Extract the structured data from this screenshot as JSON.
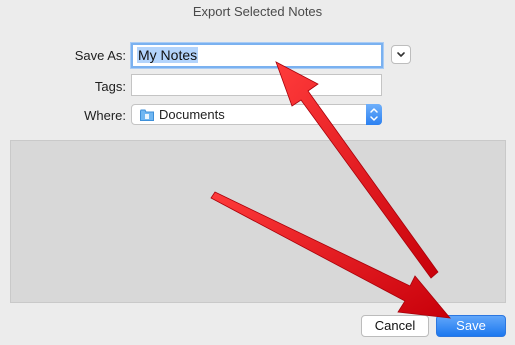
{
  "dialog": {
    "title": "Export Selected Notes"
  },
  "form": {
    "save_as_label": "Save As:",
    "save_as_value": "My Notes",
    "tags_label": "Tags:",
    "tags_value": "",
    "where_label": "Where:",
    "where_value": "Documents",
    "where_icon": "folder-icon"
  },
  "buttons": {
    "cancel_label": "Cancel",
    "save_label": "Save"
  },
  "colors": {
    "accent": "#2b80f1",
    "annotation_arrow": "#e0101a"
  }
}
